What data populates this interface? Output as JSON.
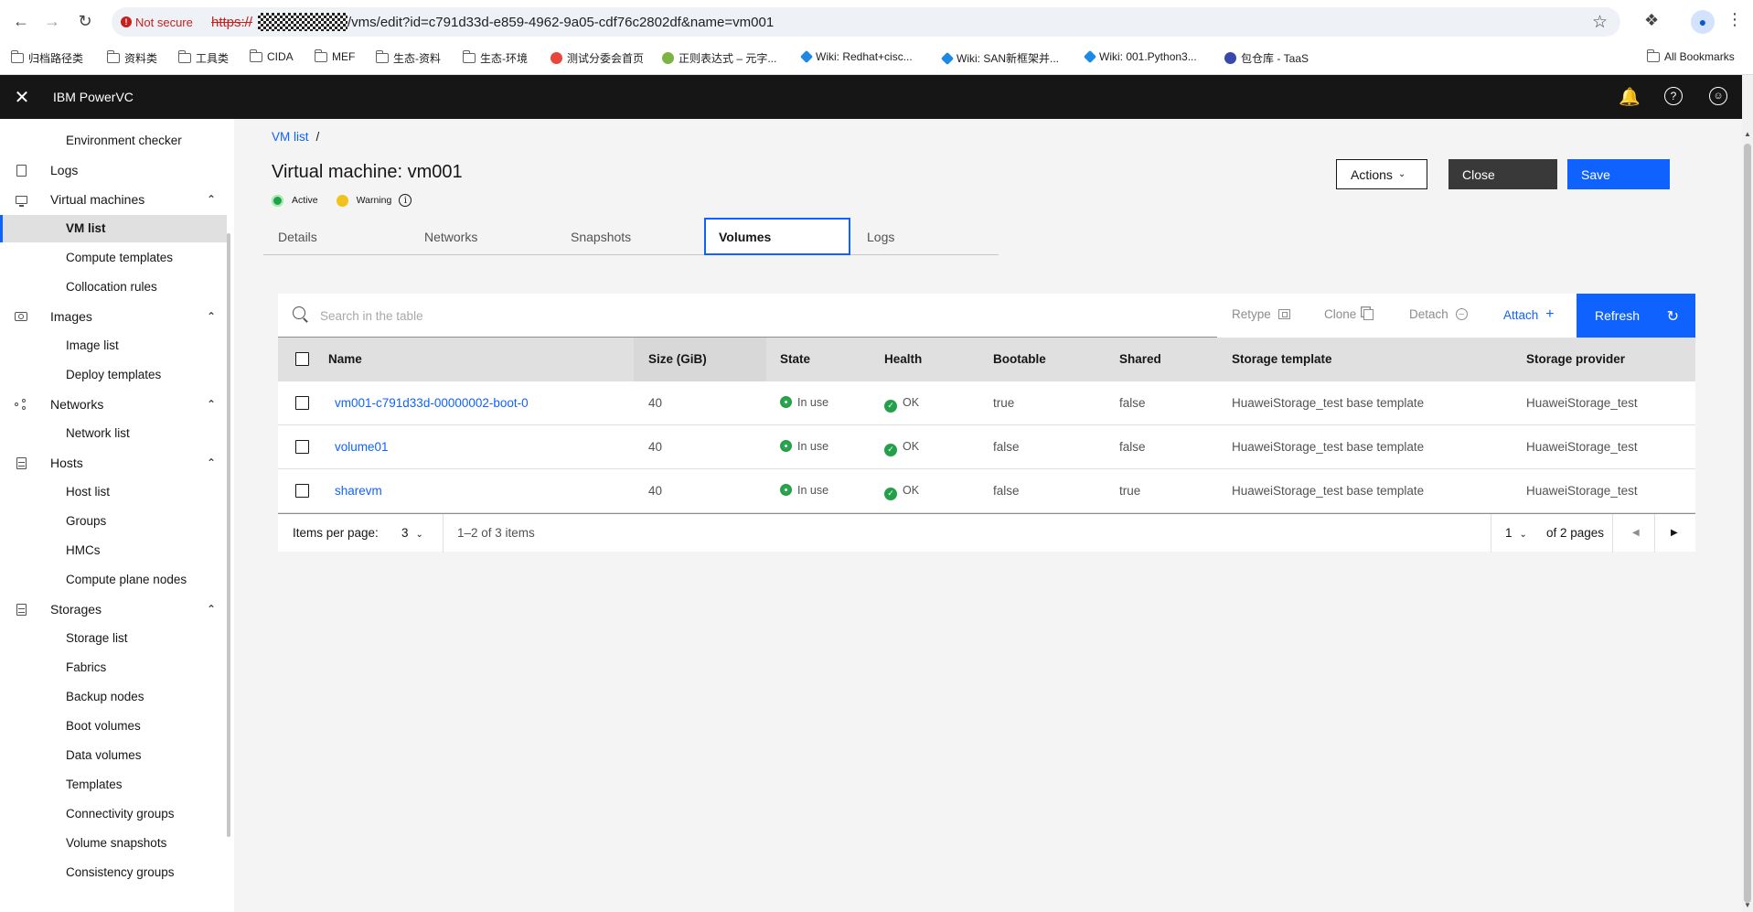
{
  "browser": {
    "not_secure": "Not secure",
    "url_scheme": "https://",
    "url_path": "/vms/edit?id=c791d33d-e859-4962-9a05-cdf76c2802df&name=vm001",
    "bookmarks": [
      {
        "label": "归档路径类",
        "icon": "folder-icon"
      },
      {
        "label": "资料类",
        "icon": "folder-icon"
      },
      {
        "label": "工具类",
        "icon": "folder-icon"
      },
      {
        "label": "CIDA",
        "icon": "folder-icon"
      },
      {
        "label": "MEF",
        "icon": "folder-icon"
      },
      {
        "label": "生态-资料",
        "icon": "folder-icon"
      },
      {
        "label": "生态-环境",
        "icon": "folder-icon"
      },
      {
        "label": "测试分委会首页",
        "icon": "site-icon"
      },
      {
        "label": "正则表达式 – 元字...",
        "icon": "site-icon"
      },
      {
        "label": "Wiki: Redhat+cisc...",
        "icon": "wiki-icon"
      },
      {
        "label": "Wiki: SAN新框架并...",
        "icon": "wiki-icon"
      },
      {
        "label": "Wiki: 001.Python3...",
        "icon": "wiki-icon"
      },
      {
        "label": "包仓库 - TaaS",
        "icon": "site-icon"
      }
    ],
    "all_bookmarks": "All Bookmarks"
  },
  "header": {
    "title": "IBM PowerVC"
  },
  "sidebar": {
    "top_item": "Environment checker",
    "logs": "Logs",
    "virtual_machines": {
      "label": "Virtual machines",
      "items": [
        "VM list",
        "Compute templates",
        "Collocation rules"
      ]
    },
    "images": {
      "label": "Images",
      "items": [
        "Image list",
        "Deploy templates"
      ]
    },
    "networks": {
      "label": "Networks",
      "items": [
        "Network list"
      ]
    },
    "hosts": {
      "label": "Hosts",
      "items": [
        "Host list",
        "Groups",
        "HMCs",
        "Compute plane nodes"
      ]
    },
    "storages": {
      "label": "Storages",
      "items": [
        "Storage list",
        "Fabrics",
        "Backup nodes",
        "Boot volumes",
        "Data volumes",
        "Templates",
        "Connectivity groups",
        "Volume snapshots",
        "Consistency groups"
      ]
    }
  },
  "main": {
    "breadcrumb": {
      "link": "VM list",
      "separator": "/"
    },
    "title": "Virtual machine: vm001",
    "status": {
      "active": "Active",
      "warning": "Warning"
    },
    "actions": {
      "actions": "Actions",
      "close": "Close",
      "save": "Save"
    },
    "tabs": [
      "Details",
      "Networks",
      "Snapshots",
      "Volumes",
      "Logs"
    ],
    "active_tab": "Volumes"
  },
  "table": {
    "search_placeholder": "Search in the table",
    "toolbar": {
      "retype": "Retype",
      "clone": "Clone",
      "detach": "Detach",
      "attach": "Attach",
      "refresh": "Refresh"
    },
    "columns": [
      "Name",
      "Size (GiB)",
      "State",
      "Health",
      "Bootable",
      "Shared",
      "Storage template",
      "Storage provider"
    ],
    "rows": [
      {
        "name": "vm001-c791d33d-00000002-boot-0",
        "size": "40",
        "state": "In use",
        "health": "OK",
        "bootable": "true",
        "shared": "false",
        "template": "HuaweiStorage_test base template",
        "provider": "HuaweiStorage_test"
      },
      {
        "name": "volume01",
        "size": "40",
        "state": "In use",
        "health": "OK",
        "bootable": "false",
        "shared": "false",
        "template": "HuaweiStorage_test base template",
        "provider": "HuaweiStorage_test"
      },
      {
        "name": "sharevm",
        "size": "40",
        "state": "In use",
        "health": "OK",
        "bootable": "false",
        "shared": "true",
        "template": "HuaweiStorage_test base template",
        "provider": "HuaweiStorage_test"
      }
    ],
    "pagination": {
      "items_per_page_label": "Items per page:",
      "items_per_page": "3",
      "range": "1–2 of 3 items",
      "page": "1",
      "of_pages": "of 2 pages"
    }
  },
  "colors": {
    "primary": "#0f62fe",
    "header": "#161616",
    "success": "#24a148",
    "warning": "#f1c21b",
    "danger": "#da1e28"
  }
}
